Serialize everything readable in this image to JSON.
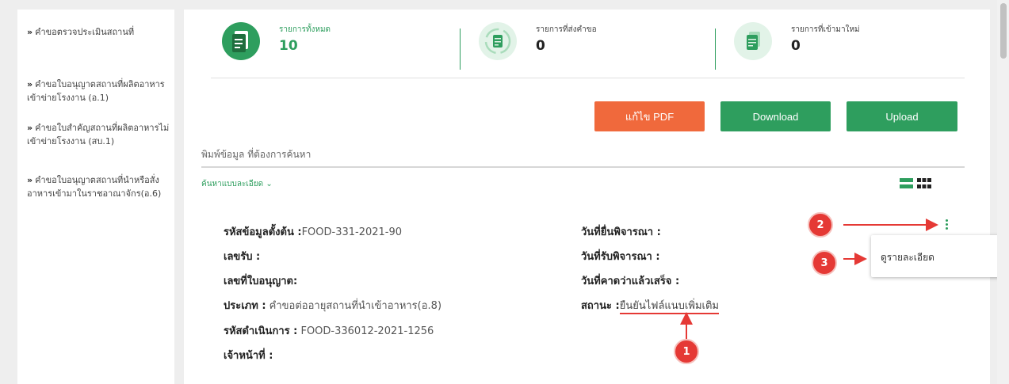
{
  "sidebar": {
    "items": [
      {
        "label": "คำขอตรวจประเมินสถานที่"
      },
      {
        "label": "คำขอใบอนุญาตสถานที่ผลิตอาหารเข้าข่ายโรงงาน (อ.1)"
      },
      {
        "label": "คำขอใบสำคัญสถานที่ผลิตอาหารไม่เข้าข่ายโรงงาน (สบ.1)"
      },
      {
        "label": "คำขอใบอนุญาตสถานที่นำหรือสั่งอาหารเข้ามาในราชอาณาจักร(อ.6)"
      }
    ],
    "chevron": "»"
  },
  "stats": [
    {
      "label": "รายการทั้งหมด",
      "value": "10",
      "icon": "document-icon",
      "color": "#2e9e5e"
    },
    {
      "label": "รายการที่ส่งคำขอ",
      "value": "0",
      "icon": "refresh-document-icon",
      "color": "#2e9e5e"
    },
    {
      "label": "รายการที่เข้ามาใหม่",
      "value": "0",
      "icon": "new-document-icon",
      "color": "#2e9e5e"
    }
  ],
  "buttons": {
    "edit_pdf": "แก้ไข PDF",
    "download": "Download",
    "upload": "Upload"
  },
  "search": {
    "placeholder": "พิมพ์ข้อมูล ที่ต้องการค้นหา",
    "advanced": "ค้นหาแบบละเอียด ⌄"
  },
  "record": {
    "origin_code_label": "รหัสข้อมูลตั้งต้น :",
    "origin_code_value": "FOOD-331-2021-90",
    "receipt_no_label": "เลขรับ :",
    "license_no_label": "เลขที่ใบอนุญาต:",
    "type_label": "ประเภท :",
    "type_value": " คำขอต่ออายุสถานที่นำเข้าอาหาร(อ.8)",
    "process_code_label": "รหัสดำเนินการ :",
    "process_code_value": " FOOD-336012-2021-1256",
    "officer_label": "เจ้าหน้าที่ :",
    "submit_date_label": "วันที่ยื่นพิจารณา :",
    "receive_date_label": "วันที่รับพิจารณา :",
    "expected_date_label": "วันที่คาดว่าแล้วเสร็จ :",
    "status_label": "สถานะ :",
    "status_value": "ยืนยันไฟล์แนบเพิ่มเติม"
  },
  "menu": {
    "view_details": "ดูรายละเอียด"
  },
  "annotations": {
    "step1": "1",
    "step2": "2",
    "step3": "3"
  },
  "colors": {
    "accent": "#2e9e5e",
    "orange": "#f0693c",
    "annotation_red": "#e53935"
  }
}
